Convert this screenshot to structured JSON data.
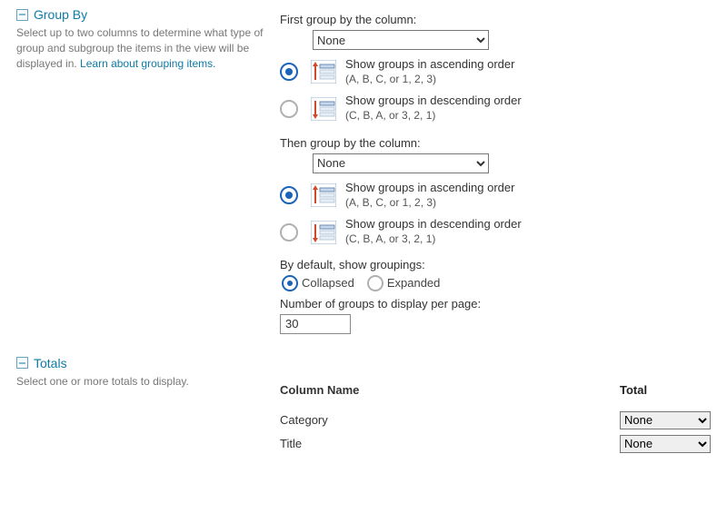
{
  "groupBy": {
    "title": "Group By",
    "description": "Select up to two columns to determine what type of group and subgroup the items in the view will be displayed in. ",
    "learnLink": "Learn about grouping items.",
    "firstLabel": "First group by the column:",
    "thenLabel": "Then group by the column:",
    "columnOptions": [
      "None"
    ],
    "firstSelected": "None",
    "thenSelected": "None",
    "ascLabel": "Show groups in ascending order",
    "ascSub": "(A, B, C, or 1, 2, 3)",
    "descLabel": "Show groups in descending order",
    "descSub": "(C, B, A, or 3, 2, 1)",
    "defaultShowLabel": "By default, show groupings:",
    "collapsedLabel": "Collapsed",
    "expandedLabel": "Expanded",
    "groupsPerPageLabel": "Number of groups to display per page:",
    "groupsPerPage": "30"
  },
  "totals": {
    "title": "Totals",
    "description": "Select one or more totals to display.",
    "columnHeader": "Column Name",
    "totalHeader": "Total",
    "rows": [
      {
        "name": "Category",
        "total": "None"
      },
      {
        "name": "Title",
        "total": "None"
      }
    ],
    "totalOptions": [
      "None"
    ]
  }
}
